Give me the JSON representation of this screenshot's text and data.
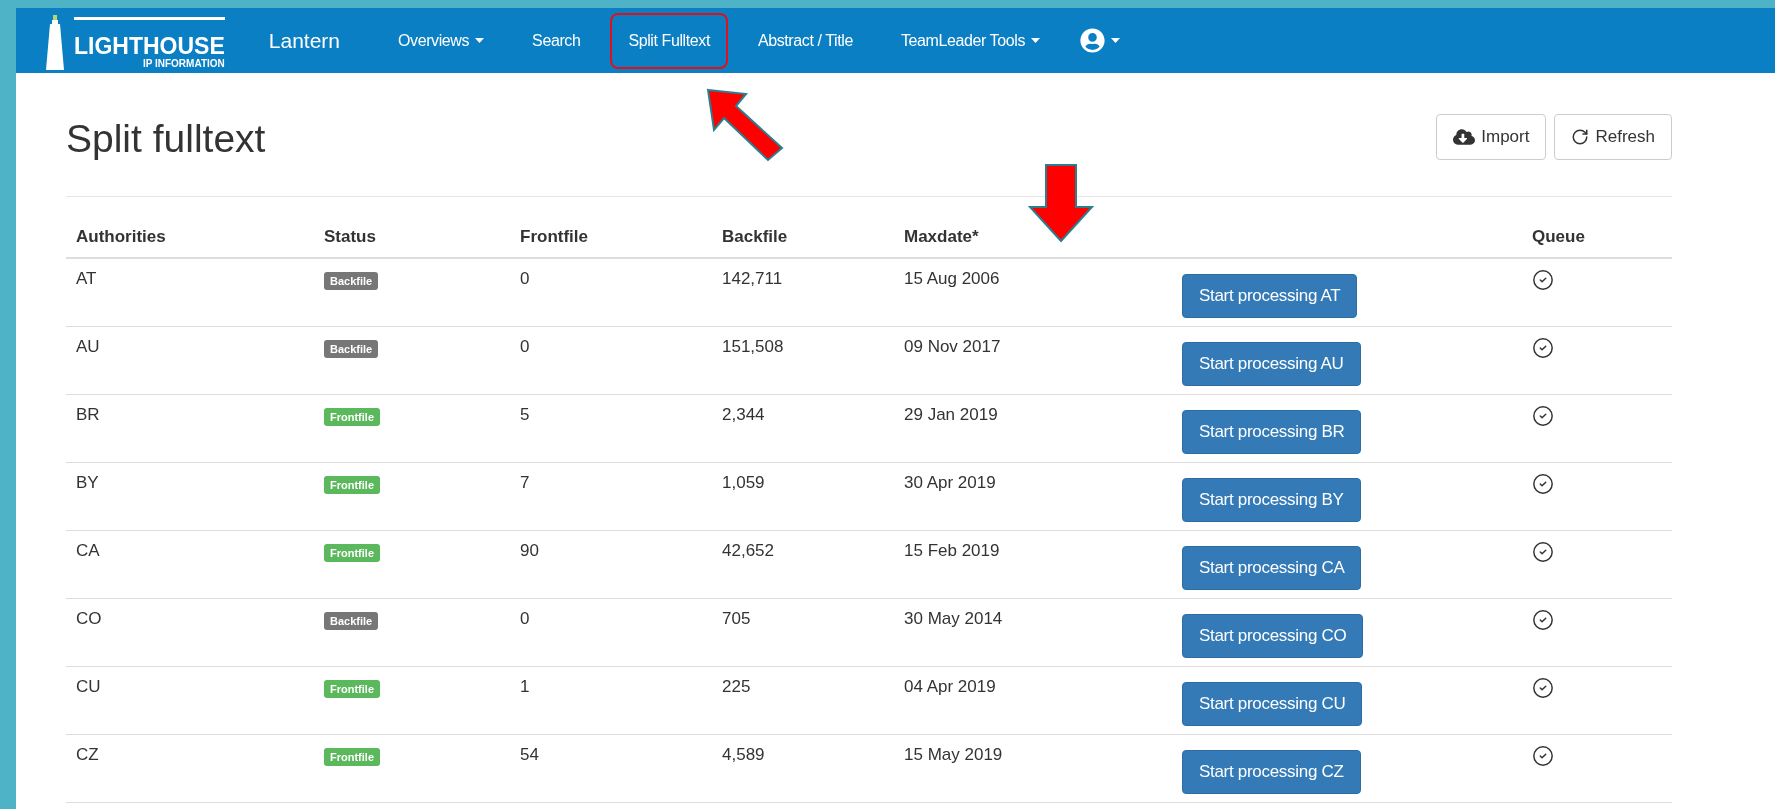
{
  "navbar": {
    "logo": {
      "title": "LIGHTHOUSE",
      "subtitle": "IP INFORMATION"
    },
    "brand": "Lantern",
    "items": [
      {
        "label": "Overviews",
        "dropdown": true,
        "highlighted": false
      },
      {
        "label": "Search",
        "dropdown": false,
        "highlighted": false
      },
      {
        "label": "Split Fulltext",
        "dropdown": false,
        "highlighted": true
      },
      {
        "label": "Abstract / Title",
        "dropdown": false,
        "highlighted": false
      },
      {
        "label": "TeamLeader Tools",
        "dropdown": true,
        "highlighted": false
      }
    ]
  },
  "page": {
    "title": "Split fulltext",
    "buttons": [
      {
        "kind": "import",
        "label": "Import"
      },
      {
        "kind": "refresh",
        "label": "Refresh"
      }
    ]
  },
  "table": {
    "columns": [
      "Authorities",
      "Status",
      "Frontfile",
      "Backfile",
      "Maxdate*",
      "",
      "Queue"
    ],
    "rows": [
      {
        "authority": "AT",
        "status": "Backfile",
        "color": "#777777",
        "frontfile": "0",
        "backfile": "142,711",
        "maxdate": "15 Aug 2006",
        "action": "Start processing AT",
        "queued": true
      },
      {
        "authority": "AU",
        "status": "Backfile",
        "color": "#777777",
        "frontfile": "0",
        "backfile": "151,508",
        "maxdate": "09 Nov 2017",
        "action": "Start processing AU",
        "queued": true
      },
      {
        "authority": "BR",
        "status": "Frontfile",
        "color": "#5cb85c",
        "frontfile": "5",
        "backfile": "2,344",
        "maxdate": "29 Jan 2019",
        "action": "Start processing BR",
        "queued": true
      },
      {
        "authority": "BY",
        "status": "Frontfile",
        "color": "#5cb85c",
        "frontfile": "7",
        "backfile": "1,059",
        "maxdate": "30 Apr 2019",
        "action": "Start processing BY",
        "queued": true
      },
      {
        "authority": "CA",
        "status": "Frontfile",
        "color": "#5cb85c",
        "frontfile": "90",
        "backfile": "42,652",
        "maxdate": "15 Feb 2019",
        "action": "Start processing CA",
        "queued": true
      },
      {
        "authority": "CO",
        "status": "Backfile",
        "color": "#777777",
        "frontfile": "0",
        "backfile": "705",
        "maxdate": "30 May 2014",
        "action": "Start processing CO",
        "queued": true
      },
      {
        "authority": "CU",
        "status": "Frontfile",
        "color": "#5cb85c",
        "frontfile": "1",
        "backfile": "225",
        "maxdate": "04 Apr 2019",
        "action": "Start processing CU",
        "queued": true
      },
      {
        "authority": "CZ",
        "status": "Frontfile",
        "color": "#5cb85c",
        "frontfile": "54",
        "backfile": "4,589",
        "maxdate": "15 May 2019",
        "action": "Start processing CZ",
        "queued": true
      }
    ]
  },
  "annotations": [
    {
      "kind": "arrow-up-left"
    },
    {
      "kind": "arrow-down"
    }
  ]
}
